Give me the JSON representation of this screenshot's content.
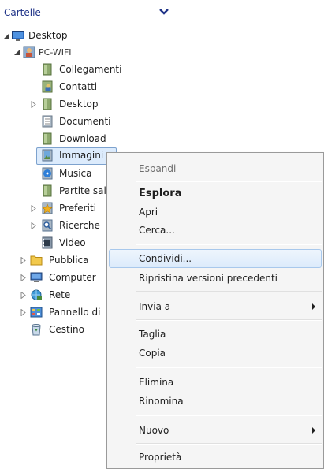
{
  "panel": {
    "title": "Cartelle",
    "tree": [
      {
        "label": "Desktop",
        "icon": "desktop-icon",
        "expander": "expanded"
      },
      {
        "label": "PC-WIFI",
        "icon": "user-folder-icon",
        "expander": "expanded"
      },
      {
        "label": "Collegamenti",
        "icon": "folder-icon",
        "expander": "none"
      },
      {
        "label": "Contatti",
        "icon": "contacts-folder-icon",
        "expander": "none"
      },
      {
        "label": "Desktop",
        "icon": "folder-icon",
        "expander": "collapsed"
      },
      {
        "label": "Documenti",
        "icon": "documents-folder-icon",
        "expander": "none"
      },
      {
        "label": "Download",
        "icon": "folder-icon",
        "expander": "none"
      },
      {
        "label": "Immagini",
        "icon": "pictures-folder-icon",
        "expander": "none",
        "selected": true
      },
      {
        "label": "Musica",
        "icon": "music-folder-icon",
        "expander": "none"
      },
      {
        "label": "Partite sal",
        "icon": "folder-icon",
        "expander": "none"
      },
      {
        "label": "Preferiti",
        "icon": "favorites-folder-icon",
        "expander": "collapsed"
      },
      {
        "label": "Ricerche",
        "icon": "searches-folder-icon",
        "expander": "collapsed"
      },
      {
        "label": "Video",
        "icon": "video-folder-icon",
        "expander": "none"
      },
      {
        "label": "Pubblica",
        "icon": "folder-icon",
        "expander": "collapsed"
      },
      {
        "label": "Computer",
        "icon": "computer-icon",
        "expander": "collapsed"
      },
      {
        "label": "Rete",
        "icon": "network-icon",
        "expander": "collapsed"
      },
      {
        "label": "Pannello di",
        "icon": "control-panel-icon",
        "expander": "collapsed"
      },
      {
        "label": "Cestino",
        "icon": "recycle-bin-icon",
        "expander": "none"
      }
    ]
  },
  "context_menu": {
    "items": [
      {
        "label": "Espandi",
        "state": "disabled"
      },
      {
        "label": "Esplora",
        "state": "default"
      },
      {
        "label": "Apri",
        "state": "normal"
      },
      {
        "label": "Cerca...",
        "state": "normal"
      },
      {
        "label": "Condividi...",
        "state": "hover"
      },
      {
        "label": "Ripristina versioni precedenti",
        "state": "normal"
      },
      {
        "label": "Invia a",
        "state": "normal",
        "submenu": true
      },
      {
        "label": "Taglia",
        "state": "normal"
      },
      {
        "label": "Copia",
        "state": "normal"
      },
      {
        "label": "Elimina",
        "state": "normal"
      },
      {
        "label": "Rinomina",
        "state": "normal"
      },
      {
        "label": "Nuovo",
        "state": "normal",
        "submenu": true
      },
      {
        "label": "Proprietà",
        "state": "normal"
      }
    ]
  },
  "colors": {
    "title_blue": "#1e3287",
    "selection_fill": "#dcebfc",
    "selection_border": "#7da2ce",
    "menu_background": "#f5f5f5",
    "menu_hover": "#dcebfb"
  }
}
